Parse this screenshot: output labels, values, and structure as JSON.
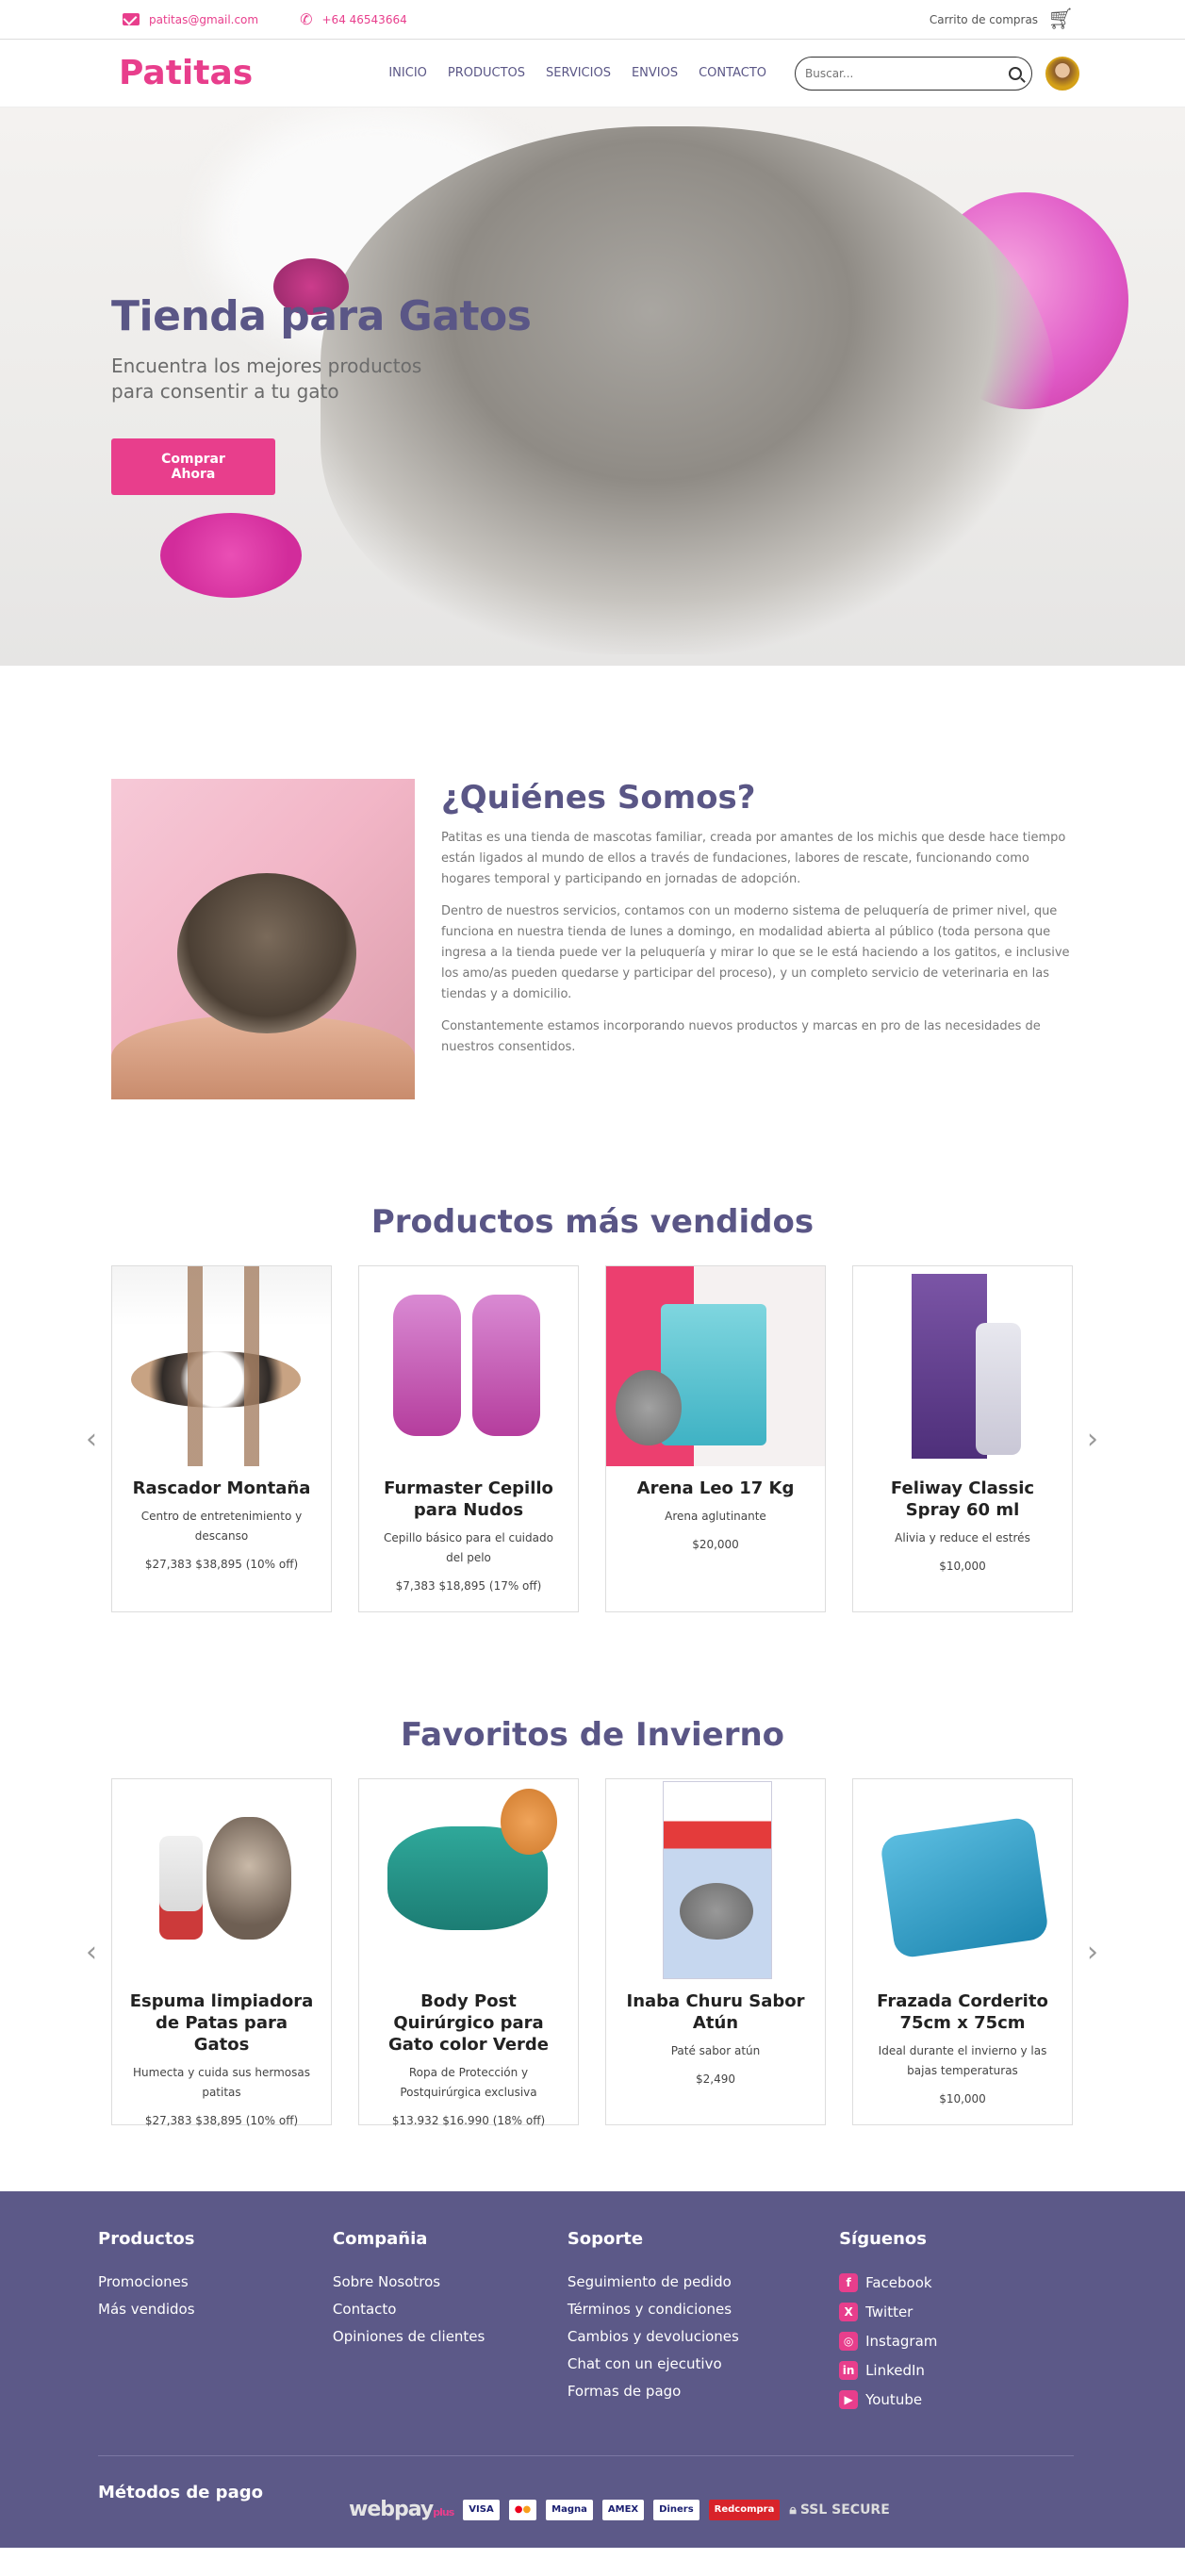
{
  "topbar": {
    "email": "patitas@gmail.com",
    "phone": "+64 46543664",
    "cart_label": "Carrito de compras"
  },
  "header": {
    "logo": "Patitas",
    "nav": [
      "INICIO",
      "PRODUCTOS",
      "SERVICIOS",
      "ENVIOS",
      "CONTACTO"
    ],
    "search_placeholder": "Buscar..."
  },
  "hero": {
    "title": "Tienda para Gatos",
    "subtitle": "Encuentra los mejores productos para consentir a tu gato",
    "cta": "Comprar Ahora"
  },
  "about": {
    "title": "¿Quiénes Somos?",
    "paragraphs": [
      "Patitas es una tienda de mascotas familiar, creada por amantes de los michis que desde hace tiempo están ligados al mundo de ellos a través de fundaciones, labores de rescate, funcionando como hogares temporal y participando en jornadas de adopción.",
      "Dentro de nuestros servicios, contamos con un moderno sistema de peluquería de primer nivel, que funciona en nuestra tienda de lunes a domingo, en modalidad abierta al público (toda persona que ingresa a la tienda puede ver la peluquería y mirar lo que se le está haciendo a los gatitos, e inclusive los amo/as pueden quedarse y participar del proceso), y un completo servicio de veterinaria en las tiendas y a domicilio.",
      "Constantemente estamos incorporando nuevos productos y marcas en pro de las necesidades de nuestros consentidos."
    ]
  },
  "bestsellers": {
    "title": "Productos más vendidos",
    "products": [
      {
        "name": "Rascador Montaña",
        "desc": "Centro de entretenimiento y descanso",
        "price": "$27,383 $38,895 (10% off)"
      },
      {
        "name": "Furmaster Cepillo para Nudos",
        "desc": "Cepillo básico para el cuidado del pelo",
        "price": "$7,383 $18,895 (17% off)"
      },
      {
        "name": "Arena Leo 17 Kg",
        "desc": "Arena aglutinante",
        "price": "$20,000"
      },
      {
        "name": "Feliway Classic Spray 60 ml",
        "desc": "Alivia y reduce el estrés",
        "price": "$10,000"
      }
    ]
  },
  "winter": {
    "title": "Favoritos de Invierno",
    "products": [
      {
        "name": "Espuma limpiadora de Patas para Gatos",
        "desc": "Humecta y cuida sus hermosas patitas",
        "price": "$27,383 $38,895 (10% off)"
      },
      {
        "name": "Body Post Quirúrgico para Gato color Verde",
        "desc": "Ropa de Protección y Postquirúrgica exclusiva",
        "price": "$13.932 $16.990 (18% off)"
      },
      {
        "name": "Inaba Churu Sabor Atún",
        "desc": "Paté sabor atún",
        "price": "$2,490"
      },
      {
        "name": "Frazada Corderito 75cm x 75cm",
        "desc": "Ideal durante el invierno y las bajas temperaturas",
        "price": "$10,000"
      }
    ]
  },
  "footer": {
    "columns": [
      {
        "title": "Productos",
        "items": [
          "Promociones",
          "Más vendidos"
        ]
      },
      {
        "title": "Compañia",
        "items": [
          "Sobre Nosotros",
          "Contacto",
          "Opiniones de clientes"
        ]
      },
      {
        "title": "Soporte",
        "items": [
          "Seguimiento de pedido",
          "Términos y condiciones",
          "Cambios y devoluciones",
          "Chat con un ejecutivo",
          "Formas de pago"
        ]
      }
    ],
    "social_title": "Síguenos",
    "social": [
      {
        "label": "Facebook",
        "icon": "facebook-icon",
        "glyph": "f"
      },
      {
        "label": "Twitter",
        "icon": "x-twitter-icon",
        "glyph": "X"
      },
      {
        "label": "Instagram",
        "icon": "instagram-icon",
        "glyph": "◎"
      },
      {
        "label": "LinkedIn",
        "icon": "linkedin-icon",
        "glyph": "in"
      },
      {
        "label": "Youtube",
        "icon": "youtube-icon",
        "glyph": "▶"
      }
    ],
    "payment_title": "Métodos de pago",
    "payment_logos": [
      "webpay",
      "VISA",
      "Mastercard",
      "Magna",
      "American Express",
      "Diners",
      "Redcompra",
      "SSL SECURE"
    ]
  },
  "colors": {
    "accent": "#e83e8c",
    "brand_purple": "#5a5686",
    "footer_bg": "#5c5988"
  }
}
